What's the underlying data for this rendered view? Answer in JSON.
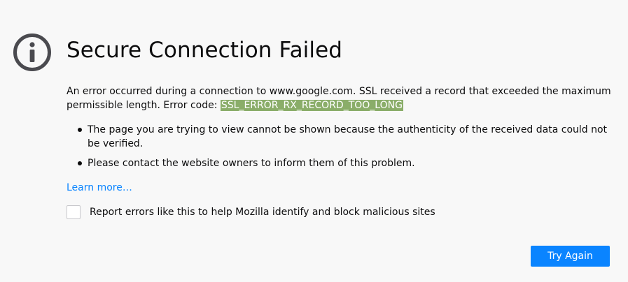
{
  "error_page": {
    "title": "Secure Connection Failed",
    "description_text": "An error occurred during a connection to www.google.com. SSL received a record that exceeded the maximum permissible length. Error code: ",
    "error_code": "SSL_ERROR_RX_RECORD_TOO_LONG",
    "bullets": [
      "The page you are trying to view cannot be shown because the authenticity of the received data could not be verified.",
      "Please contact the website owners to inform them of this problem."
    ],
    "learn_more_label": "Learn more…",
    "report_checkbox": {
      "label": "Report errors like this to help Mozilla identify and block malicious sites",
      "checked": false
    },
    "try_again_label": "Try Again"
  },
  "colors": {
    "background": "#f8f8f8",
    "icon": "#4a4a4f",
    "error_code_highlight": "#8aad69",
    "link": "#0a84ff",
    "primary_button": "#0a84ff"
  },
  "icons": {
    "info": "info-circle-icon"
  }
}
